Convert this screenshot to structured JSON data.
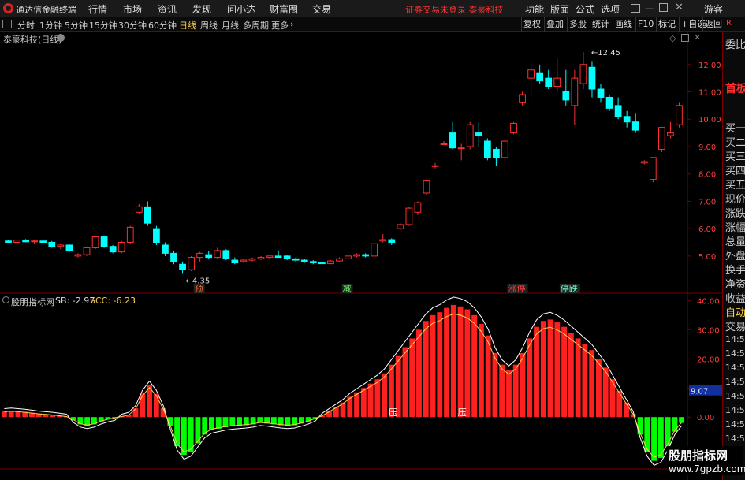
{
  "titlebar": {
    "app_title": "通达信金融终端",
    "menus": [
      "行情",
      "市场",
      "资讯",
      "发现",
      "问小达",
      "财富圈",
      "交易"
    ],
    "warning": "证券交易未登录 泰豪科技",
    "right_menus": [
      "功能",
      "版面",
      "公式",
      "选项"
    ],
    "guest": "游客"
  },
  "periods": [
    "分时",
    "1分钟",
    "5分钟",
    "15分钟",
    "30分钟",
    "60分钟",
    "日线",
    "周线",
    "月线",
    "多周期",
    "更多"
  ],
  "active_period": "日线",
  "tools": [
    "复权",
    "叠加",
    "多股",
    "统计",
    "画线",
    "F10",
    "标记",
    "+自选",
    "返回"
  ],
  "stock_label": "泰豪科技(日线)",
  "indicator": {
    "name": "股朋指标网",
    "sb": "SB: -2.97",
    "scc": "SCC: -6.23"
  },
  "side_panel": {
    "top": "委比",
    "first": "首板",
    "items": [
      "买一",
      "买二",
      "买三",
      "买四",
      "买五",
      "现价",
      "涨跌",
      "涨幅",
      "总量",
      "外盘",
      "换手",
      "净资",
      "收益"
    ],
    "auto": "自动",
    "trade": "交易",
    "times": [
      "14:5",
      "14:5",
      "14:5",
      "14:5",
      "14:5",
      "14:5",
      "14:5",
      "14:5"
    ]
  },
  "watermark": {
    "name": "股朋指标网",
    "url": "www.7gpzb.com"
  },
  "colors": {
    "up": "#ff3030",
    "down": "#00ffff",
    "green": "#00ff00",
    "axis": "#7a0000",
    "label_up": "#ff4040"
  },
  "chart_data": {
    "type": "candlestick",
    "price_axis": {
      "ticks": [
        5.0,
        6.0,
        7.0,
        8.0,
        9.0,
        10.0,
        11.0,
        12.0
      ],
      "range": [
        3.7,
        12.8
      ]
    },
    "annotations": {
      "high": "12.45",
      "low": "4.35",
      "high_value": 12.45,
      "low_value": 4.35
    },
    "markers": [
      {
        "text": "预",
        "index": 22,
        "color": "#ff6633"
      },
      {
        "text": "减",
        "index": 39,
        "color": "#66ff66"
      },
      {
        "text": "涨停",
        "index": 58,
        "color": "#ff4040"
      },
      {
        "text": "停跌",
        "index": 64,
        "color": "#66ffcc"
      }
    ],
    "ohlc": [
      [
        5.55,
        5.6,
        5.5,
        5.5
      ],
      [
        5.5,
        5.6,
        5.45,
        5.58
      ],
      [
        5.58,
        5.62,
        5.5,
        5.52
      ],
      [
        5.52,
        5.6,
        5.45,
        5.55
      ],
      [
        5.55,
        5.6,
        5.5,
        5.5
      ],
      [
        5.5,
        5.55,
        5.3,
        5.35
      ],
      [
        5.35,
        5.45,
        5.25,
        5.4
      ],
      [
        5.4,
        5.45,
        5.15,
        5.2
      ],
      [
        5.0,
        5.1,
        4.95,
        5.05
      ],
      [
        5.05,
        5.35,
        5.0,
        5.3
      ],
      [
        5.3,
        5.75,
        5.25,
        5.7
      ],
      [
        5.7,
        5.75,
        5.3,
        5.35
      ],
      [
        5.35,
        5.4,
        5.1,
        5.15
      ],
      [
        5.15,
        5.55,
        5.1,
        5.5
      ],
      [
        5.5,
        6.1,
        5.45,
        6.05
      ],
      [
        6.6,
        6.9,
        6.55,
        6.8
      ],
      [
        6.8,
        7.0,
        6.1,
        6.2
      ],
      [
        6.0,
        6.1,
        5.4,
        5.5
      ],
      [
        5.4,
        5.5,
        5.0,
        5.1
      ],
      [
        5.1,
        5.2,
        4.7,
        4.8
      ],
      [
        4.7,
        4.8,
        4.35,
        4.5
      ],
      [
        4.5,
        5.0,
        4.45,
        4.95
      ],
      [
        4.95,
        5.15,
        4.8,
        5.1
      ],
      [
        5.05,
        5.2,
        4.9,
        4.95
      ],
      [
        4.95,
        5.3,
        4.9,
        5.2
      ],
      [
        5.2,
        5.25,
        4.85,
        4.9
      ],
      [
        4.85,
        4.95,
        4.7,
        4.75
      ],
      [
        4.8,
        4.9,
        4.75,
        4.85
      ],
      [
        4.85,
        4.95,
        4.8,
        4.9
      ],
      [
        4.9,
        5.0,
        4.85,
        4.95
      ],
      [
        4.95,
        5.05,
        4.9,
        5.0
      ],
      [
        5.0,
        5.2,
        4.95,
        4.95
      ],
      [
        5.0,
        5.05,
        4.85,
        4.9
      ],
      [
        4.9,
        4.95,
        4.8,
        4.85
      ],
      [
        4.85,
        4.9,
        4.75,
        4.8
      ],
      [
        4.8,
        4.85,
        4.7,
        4.75
      ],
      [
        4.75,
        4.8,
        4.7,
        4.72
      ],
      [
        4.72,
        4.85,
        4.7,
        4.82
      ],
      [
        4.82,
        4.95,
        4.8,
        4.9
      ],
      [
        4.9,
        5.05,
        4.85,
        5.0
      ],
      [
        5.0,
        5.1,
        4.95,
        5.05
      ],
      [
        5.05,
        5.1,
        4.95,
        5.0
      ],
      [
        5.0,
        5.45,
        4.98,
        5.45
      ],
      [
        5.55,
        5.8,
        5.5,
        5.6
      ],
      [
        5.6,
        5.65,
        5.4,
        5.5
      ],
      [
        6.0,
        6.2,
        5.95,
        6.15
      ],
      [
        6.15,
        6.8,
        6.1,
        6.75
      ],
      [
        6.6,
        7.0,
        6.5,
        6.95
      ],
      [
        7.3,
        7.8,
        7.25,
        7.75
      ],
      [
        8.3,
        8.4,
        8.2,
        8.3
      ],
      [
        9.1,
        9.2,
        9.05,
        9.1
      ],
      [
        9.5,
        9.9,
        8.9,
        8.95
      ],
      [
        8.95,
        9.1,
        8.5,
        8.95
      ],
      [
        9.0,
        9.9,
        8.9,
        9.8
      ],
      [
        9.5,
        9.9,
        9.0,
        9.4
      ],
      [
        9.2,
        9.3,
        8.5,
        8.6
      ],
      [
        8.9,
        9.0,
        8.3,
        8.6
      ],
      [
        8.6,
        9.3,
        8.0,
        9.2
      ],
      [
        9.5,
        9.9,
        9.45,
        9.85
      ],
      [
        10.6,
        11.0,
        10.5,
        10.9
      ],
      [
        11.5,
        12.1,
        10.8,
        11.8
      ],
      [
        11.7,
        12.0,
        11.3,
        11.4
      ],
      [
        11.5,
        11.8,
        11.1,
        11.2
      ],
      [
        11.2,
        12.2,
        11.0,
        11.5
      ],
      [
        11.0,
        11.8,
        10.5,
        10.7
      ],
      [
        10.5,
        11.8,
        9.8,
        11.5
      ],
      [
        11.3,
        12.45,
        11.1,
        12.0
      ],
      [
        11.9,
        12.1,
        10.8,
        11.1
      ],
      [
        11.1,
        11.3,
        10.6,
        10.8
      ],
      [
        10.8,
        10.9,
        10.3,
        10.4
      ],
      [
        10.5,
        10.8,
        10.0,
        10.1
      ],
      [
        10.1,
        10.3,
        9.7,
        9.9
      ],
      [
        9.9,
        10.2,
        9.5,
        9.6
      ],
      [
        8.4,
        8.5,
        8.35,
        8.45
      ],
      [
        7.8,
        8.2,
        7.7,
        8.6
      ],
      [
        8.9,
        9.5,
        8.8,
        9.7
      ],
      [
        9.4,
        9.9,
        9.3,
        9.5
      ],
      [
        9.8,
        10.6,
        9.7,
        10.5
      ]
    ],
    "indicator_axis": {
      "ticks": [
        0.0,
        10.0,
        20.0,
        30.0,
        40.0
      ],
      "range": [
        -17,
        42
      ],
      "badge": "9.07"
    },
    "indicator_labels": [
      {
        "text": "压",
        "index": 44
      },
      {
        "text": "压",
        "index": 52
      }
    ],
    "sb_values": [
      2,
      2.2,
      2,
      1.8,
      1.5,
      1.2,
      1,
      0.8,
      0.5,
      0.2,
      -1,
      -2.5,
      -3,
      -2.5,
      -1.5,
      -0.8,
      -0.3,
      0.2,
      0.8,
      3,
      8,
      11,
      8,
      3,
      -3,
      -10,
      -13,
      -12,
      -9,
      -6,
      -4.5,
      -4,
      -3.5,
      -3.2,
      -3,
      -2.8,
      -2.5,
      -2,
      -2.2,
      -2.5,
      -2.8,
      -3,
      -2.8,
      -2.2,
      -1.5,
      -0.5,
      0.5,
      2,
      3.5,
      5,
      7,
      8.5,
      10,
      11.5,
      13,
      15,
      18,
      21,
      24,
      27,
      30,
      33,
      35,
      36,
      37.5,
      38.5,
      38,
      37,
      35,
      32,
      28,
      22,
      18,
      16,
      18,
      22,
      27,
      31,
      33,
      33.5,
      32.5,
      31,
      29,
      27,
      25,
      23,
      20,
      17,
      13,
      9,
      5,
      1,
      -6,
      -12,
      -15,
      -14,
      -10,
      -5,
      -2
    ]
  }
}
